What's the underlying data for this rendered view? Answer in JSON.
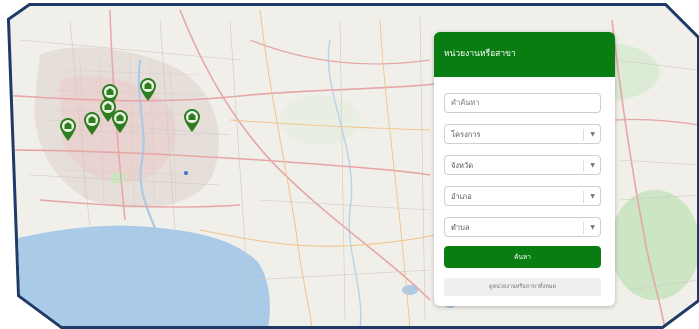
{
  "theme": {
    "accent": "#0a7d12",
    "frame_color": "#1f3a66",
    "water": "#a9cbe8",
    "land": "#f1efea"
  },
  "panel": {
    "title": "หน่วยงานหรือสาขา",
    "search_placeholder": "คำค้นหา",
    "selects": [
      {
        "name": "project",
        "label": "โครงการ"
      },
      {
        "name": "province",
        "label": "จังหวัด"
      },
      {
        "name": "district",
        "label": "อำเภอ"
      },
      {
        "name": "subdistrict",
        "label": "ตำบล"
      }
    ],
    "search_button": "ค้นหา",
    "show_all_button": "ดูหน่วยงานหรือสาขาทั้งหมด"
  },
  "map": {
    "markers": [
      {
        "icon": "bank-pin-icon"
      },
      {
        "icon": "bank-pin-icon"
      },
      {
        "icon": "bank-pin-icon"
      },
      {
        "icon": "bank-pin-icon"
      },
      {
        "icon": "bank-pin-icon"
      },
      {
        "icon": "bank-pin-icon"
      },
      {
        "icon": "bank-pin-icon"
      }
    ]
  }
}
